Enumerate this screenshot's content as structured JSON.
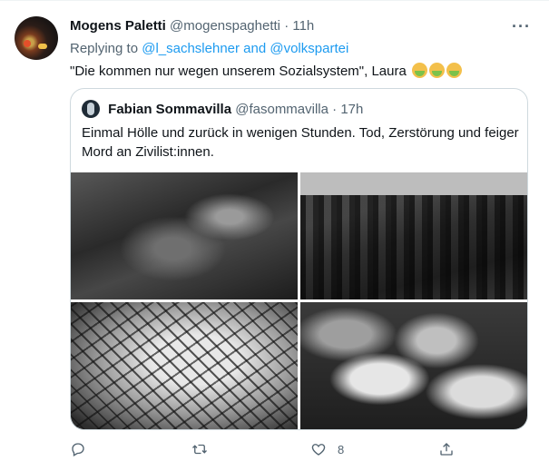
{
  "tweet": {
    "author_name": "Mogens Paletti",
    "author_handle": "@mogenspaghetti",
    "separator": "·",
    "time": "11h",
    "more_label": "···",
    "reply_prefix": "Replying to ",
    "reply_to": "@l_sachslehner and @volkspartei",
    "text": "\"Die kommen nur wegen unserem Sozialsystem\", Laura ",
    "emoji_names": [
      "face-vomiting",
      "face-vomiting",
      "face-vomiting"
    ]
  },
  "quote": {
    "author_name": "Fabian Sommavilla",
    "author_handle": "@fasommavilla",
    "separator": "·",
    "time": "17h",
    "text": "Einmal Hölle und zurück in wenigen Stunden. Tod, Zerstörung und feiger Mord an Zivilist:innen.",
    "photos": [
      "destroyed-vehicles-photo",
      "trench-grave-photo",
      "collapsed-structure-photo",
      "strollers-photo"
    ]
  },
  "actions": {
    "reply_icon": "reply-icon",
    "retweet_icon": "retweet-icon",
    "like_icon": "like-icon",
    "like_count": "8",
    "share_icon": "share-icon"
  },
  "colors": {
    "link": "#1d9bf0",
    "secondary_text": "#536471",
    "border": "#cfd9de"
  }
}
